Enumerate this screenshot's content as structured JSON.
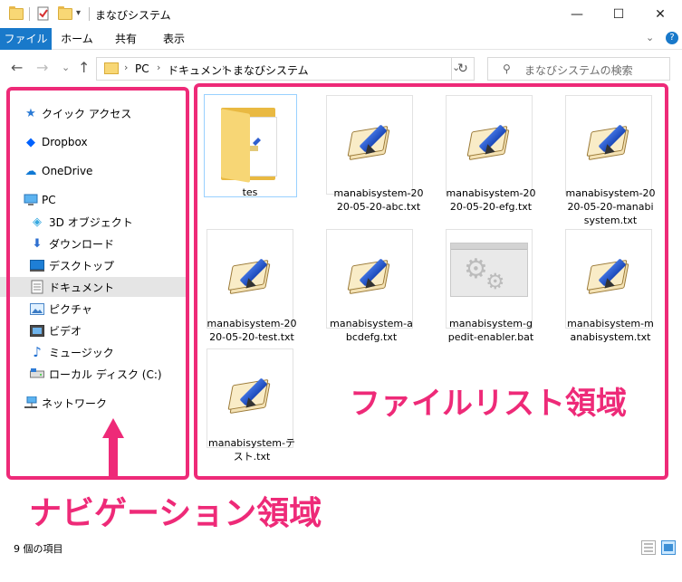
{
  "window": {
    "title": "まなびシステム",
    "controls": {
      "minimize": "—",
      "maximize": "☐",
      "close": "✕"
    }
  },
  "ribbon": {
    "tabs": [
      "ファイル",
      "ホーム",
      "共有",
      "表示"
    ],
    "expand": "⌄",
    "help": "?"
  },
  "address": {
    "back": "←",
    "forward": "→",
    "recent": "⌄",
    "up": "↑",
    "crumbs": [
      "PC",
      "ドキュメント",
      "まなびシステム"
    ],
    "sep": "›",
    "dropdown": "⌄",
    "refresh": "↻"
  },
  "search": {
    "placeholder": "まなびシステムの検索",
    "icon": "search-icon"
  },
  "nav": {
    "items": [
      {
        "label": "クイック アクセス",
        "icon": "star-icon"
      },
      {
        "label": "Dropbox",
        "icon": "dropbox-icon"
      },
      {
        "label": "OneDrive",
        "icon": "cloud-icon"
      },
      {
        "label": "PC",
        "icon": "computer-icon"
      },
      {
        "label": "3D オブジェクト",
        "icon": "cube-icon"
      },
      {
        "label": "ダウンロード",
        "icon": "download-icon"
      },
      {
        "label": "デスクトップ",
        "icon": "desktop-icon"
      },
      {
        "label": "ドキュメント",
        "icon": "document-icon",
        "selected": true
      },
      {
        "label": "ピクチャ",
        "icon": "picture-icon"
      },
      {
        "label": "ビデオ",
        "icon": "video-icon"
      },
      {
        "label": "ミュージック",
        "icon": "music-icon"
      },
      {
        "label": "ローカル ディスク (C:)",
        "icon": "disk-icon"
      },
      {
        "label": "ネットワーク",
        "icon": "network-icon"
      }
    ]
  },
  "files": [
    {
      "name": "tes",
      "type": "folder"
    },
    {
      "name": "manabisystem-20\n20-05-20-abc.txt",
      "type": "txt"
    },
    {
      "name": "manabisystem-20\n20-05-20-efg.txt",
      "type": "txt"
    },
    {
      "name": "manabisystem-20\n20-05-20-manabi\nsystem.txt",
      "type": "txt"
    },
    {
      "name": "manabisystem-20\n20-05-20-test.txt",
      "type": "txt"
    },
    {
      "name": "manabisystem-a\nbcdefg.txt",
      "type": "txt"
    },
    {
      "name": "manabisystem-g\npedit-enabler.bat",
      "type": "bat"
    },
    {
      "name": "manabisystem-m\nanabisystem.txt",
      "type": "txt"
    },
    {
      "name": "manabisystem-テ\nスト.txt",
      "type": "txt"
    }
  ],
  "annotations": {
    "file_area": "ファイルリスト領域",
    "nav_area": "ナビゲーション領域",
    "color": "#ee2a78"
  },
  "status": {
    "count": "9 個の項目"
  }
}
